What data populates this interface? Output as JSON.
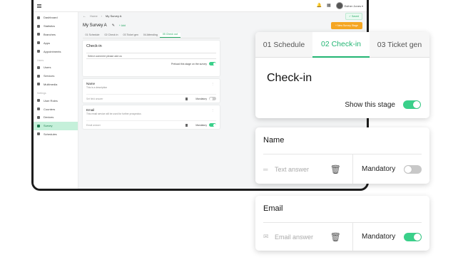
{
  "topbar": {
    "menu_icon": "menu-icon",
    "user_name": "Esther Jones"
  },
  "sidebar": {
    "items": [
      {
        "label": "Dashboard"
      },
      {
        "label": "Statistics"
      },
      {
        "label": "Branches"
      },
      {
        "label": "Apps"
      },
      {
        "label": "Appointments"
      }
    ],
    "section_users": "Users",
    "users_items": [
      {
        "label": "Users"
      },
      {
        "label": "Services"
      },
      {
        "label": "Multimedia"
      }
    ],
    "section_settings": "Settings",
    "settings_items": [
      {
        "label": "User Roles"
      },
      {
        "label": "Counters"
      },
      {
        "label": "Devices"
      },
      {
        "label": "Survey"
      },
      {
        "label": "Schedules"
      }
    ]
  },
  "breadcrumb": {
    "home": "Home",
    "current": "My Survey A"
  },
  "save_label": "✓ Saved",
  "survey": {
    "name": "My Survey A",
    "add_label": "+ Add",
    "new_stage": "+ New Survey Stage"
  },
  "mini_tabs": [
    "01 Schedule",
    "02 Check in",
    "03 Ticket gen",
    "04 Attending",
    "05 Check out"
  ],
  "mini_head": {
    "title": "Check-in",
    "input_text": "Select comment please add us",
    "show_label": "Preload this stage on the survey"
  },
  "mini_questions": [
    {
      "label": "Name",
      "desc": "This is a description",
      "answer": "Set field answer",
      "mand": "Mandatory"
    },
    {
      "label": "Email",
      "desc": "This email service will be used for further prospectus",
      "answer": "Email answer",
      "mand": "Mandatory"
    }
  ],
  "tabs": {
    "t1": "01  Schedule",
    "t2": "02  Check-in",
    "t3": "03  Ticket gen"
  },
  "stage": {
    "title": "Check-in",
    "show_label": "Show this stage",
    "show_on": true
  },
  "name_card": {
    "title": "Name",
    "placeholder": "Text answer",
    "mandatory_label": "Mandatory",
    "mandatory_on": false
  },
  "email_card": {
    "title": "Email",
    "placeholder": "Email answer",
    "mandatory_label": "Mandatory",
    "mandatory_on": true
  },
  "colors": {
    "accent": "#22b573",
    "toggle_on": "#3ad08a",
    "orange": "#f5a623"
  }
}
